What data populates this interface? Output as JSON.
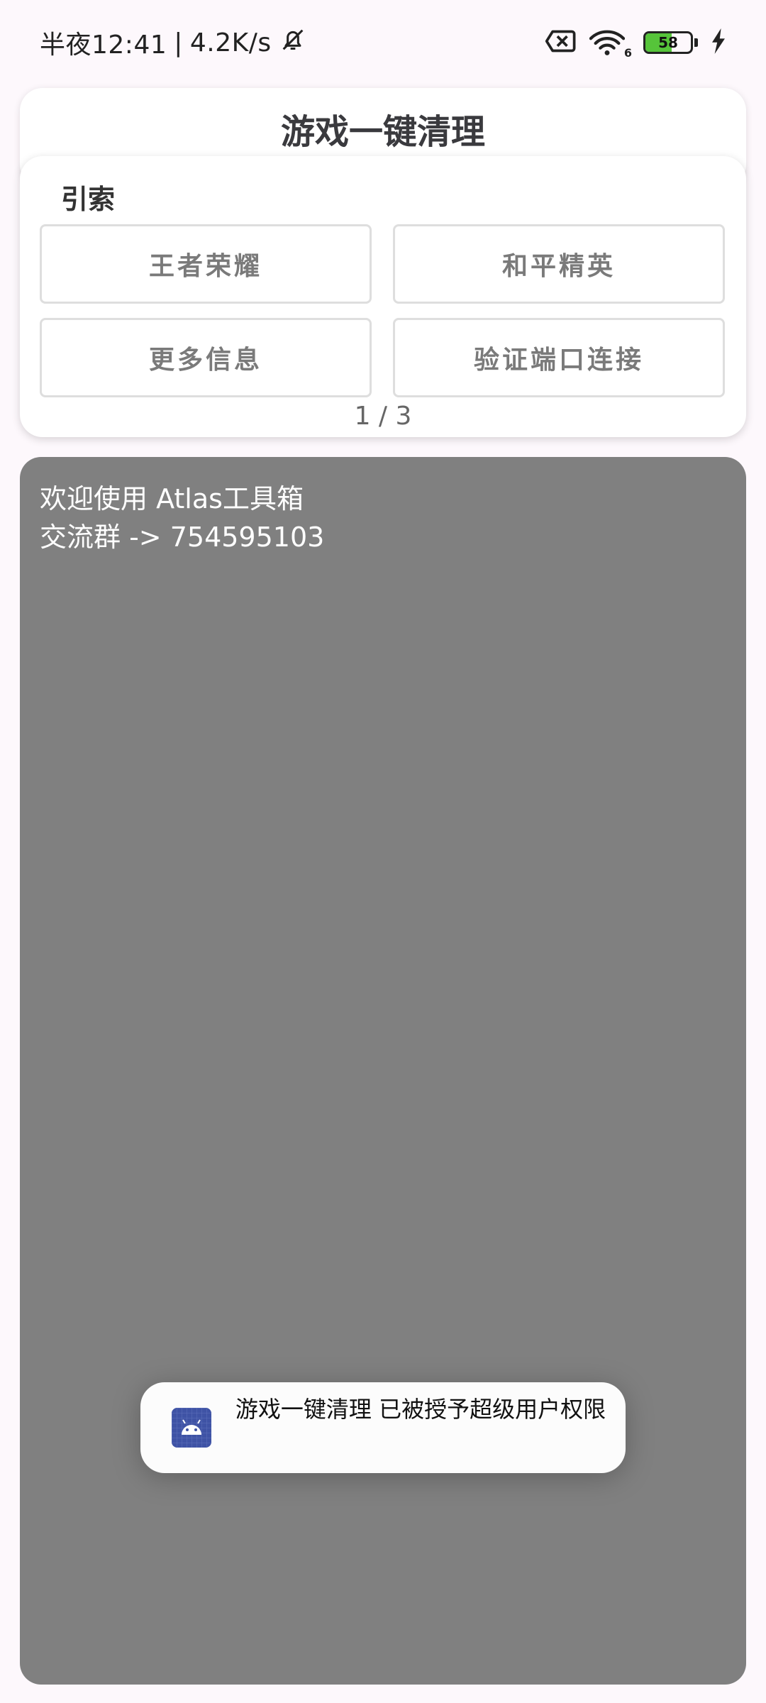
{
  "status_bar": {
    "time": "半夜12:41",
    "separator": "|",
    "net_speed": "4.2K/s",
    "network_type": "6",
    "battery_level": "58",
    "battery_fraction": 0.58,
    "icons": [
      "bell-off-icon",
      "sim-error-icon",
      "wifi-icon",
      "battery-icon",
      "charging-icon"
    ]
  },
  "header": {
    "title": "游戏一键清理"
  },
  "index_card": {
    "label": "引索",
    "buttons": [
      {
        "label": "王者荣耀"
      },
      {
        "label": "和平精英"
      },
      {
        "label": "更多信息"
      },
      {
        "label": "验证端口连接"
      }
    ],
    "pager": "1 / 3"
  },
  "log": {
    "lines": [
      "欢迎使用 Atlas工具箱",
      "交流群 -> 754595103"
    ]
  },
  "toast": {
    "icon": "android-icon",
    "message": "游戏一键清理 已被授予超级用户权限"
  },
  "colors": {
    "background": "#fdf8fc",
    "log_panel": "#808080",
    "battery_fill": "#56c43a",
    "toast_icon_bg": "#3f53a5"
  }
}
